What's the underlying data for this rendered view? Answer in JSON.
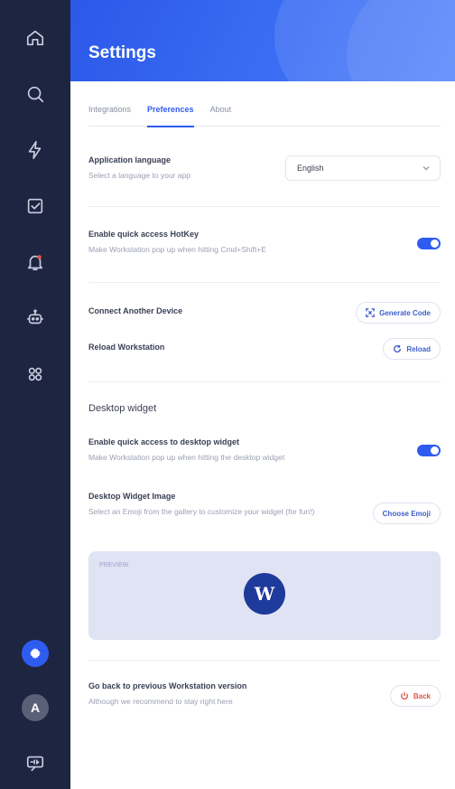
{
  "sidebar": {
    "items": [
      {
        "icon": "home-icon"
      },
      {
        "icon": "search-icon"
      },
      {
        "icon": "lightning-icon"
      },
      {
        "icon": "checkbox-icon"
      },
      {
        "icon": "bell-notification-icon"
      },
      {
        "icon": "robot-icon"
      },
      {
        "icon": "apps-grid-icon"
      }
    ],
    "active": "settings",
    "avatar_initial": "A",
    "feedback_icon": "feedback-icon"
  },
  "header": {
    "title": "Settings"
  },
  "tabs": [
    {
      "label": "Integrations",
      "active": false
    },
    {
      "label": "Preferences",
      "active": true
    },
    {
      "label": "About",
      "active": false
    }
  ],
  "settings": {
    "language": {
      "label": "Application language",
      "description": "Select a language to your app",
      "value": "English"
    },
    "hotkey": {
      "label": "Enable quick access HotKey",
      "description": "Make Workstation pop up when hitting Cmd+Shift+E",
      "enabled": true
    },
    "connect_device": {
      "label": "Connect Another Device",
      "button": "Generate Code"
    },
    "reload": {
      "label": "Reload Workstation",
      "button": "Reload"
    },
    "desktop_widget": {
      "section_title": "Desktop widget",
      "toggle_label": "Enable quick access to desktop widget",
      "toggle_description": "Make Workstation pop up when hitting the desktop widget",
      "enabled": true,
      "image_label": "Desktop Widget Image",
      "image_description": "Select an Emoji from the gallery to customize your widget (for fun!)",
      "image_button": "Choose Emoji",
      "preview_label": "PREVIEW",
      "preview_logo": "W"
    },
    "previous_version": {
      "label": "Go back to previous Workstation version",
      "description": "Although we recommend to stay right here",
      "button": "Back"
    }
  },
  "colors": {
    "accent": "#2f5cf0",
    "sidebar_bg": "#1e2540",
    "danger": "#e2564a"
  }
}
